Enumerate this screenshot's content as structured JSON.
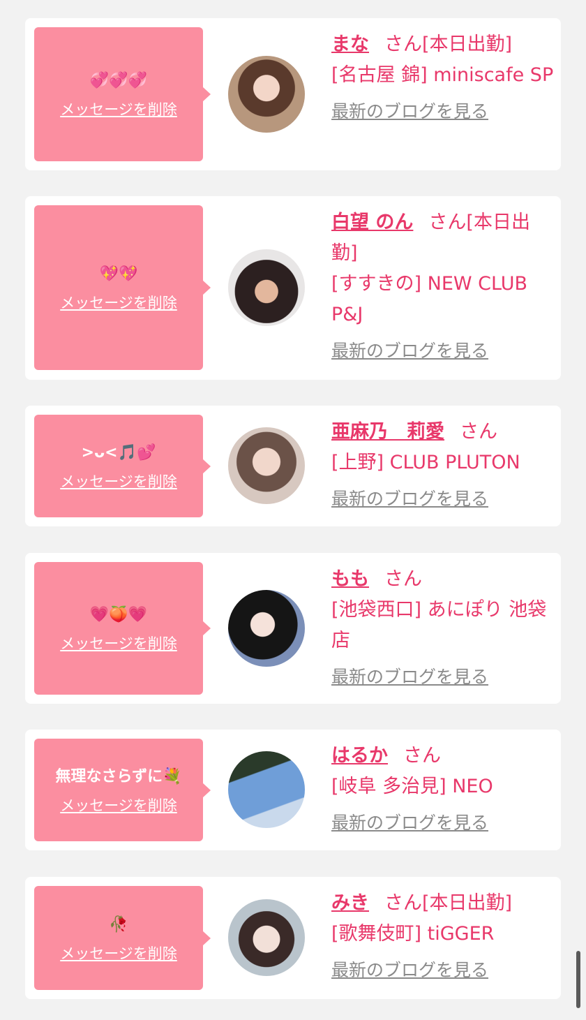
{
  "delete_label": "メッセージを削除",
  "blog_label": "最新のブログを見る",
  "colors": {
    "page_bg": "#f2f2f2",
    "bubble_pink": "#fb8ea0",
    "accent_pink": "#e8386a",
    "link_gray": "#8a8a8a"
  },
  "cards": [
    {
      "message": "💞💞💞",
      "name": "まな",
      "suffix": "さん[本日出勤]",
      "shop": "[名古屋 錦] miniscafe SP"
    },
    {
      "message": "💖💖",
      "name": "白望 のん",
      "suffix": "さん[本日出勤]",
      "shop": "[すすきの] NEW CLUB P&J"
    },
    {
      "message": ">ᴗ<🎵💕",
      "name": "亜麻乃　莉愛",
      "suffix": "さん",
      "shop": "[上野] CLUB PLUTON"
    },
    {
      "message": "💗🍑💗",
      "name": "もも",
      "suffix": "さん",
      "shop": "[池袋西口] あにぽり 池袋店"
    },
    {
      "message": "無理なさらずに💐",
      "name": "はるか",
      "suffix": "さん",
      "shop": "[岐阜 多治見] NEO"
    },
    {
      "message": "🥀",
      "name": "みき",
      "suffix": "さん[本日出勤]",
      "shop": "[歌舞伎町] tiGGER"
    }
  ]
}
